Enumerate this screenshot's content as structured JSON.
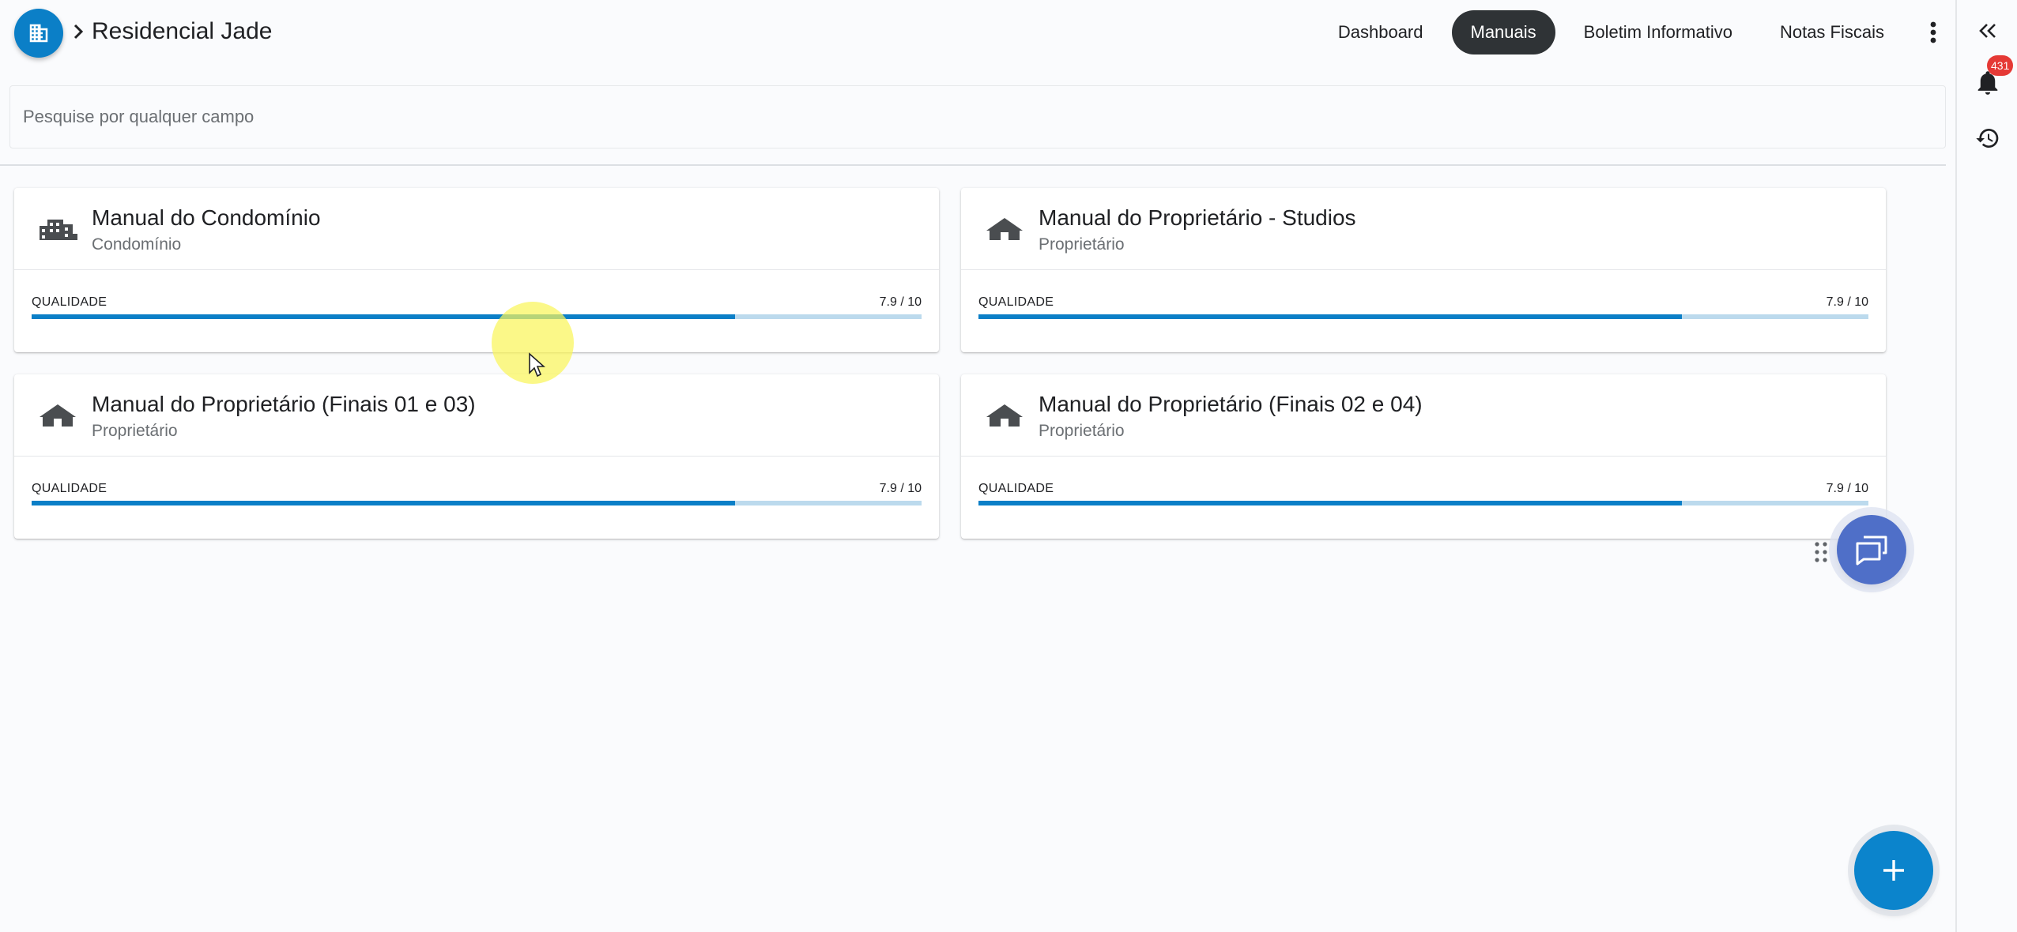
{
  "header": {
    "title": "Residencial Jade",
    "nav": [
      "Dashboard",
      "Manuais",
      "Boletim Informativo",
      "Notas Fiscais"
    ],
    "active_nav": "Manuais"
  },
  "search": {
    "placeholder": "Pesquise por qualquer campo",
    "value": ""
  },
  "cards": [
    {
      "title": "Manual do Condomínio",
      "subtitle": "Condomínio",
      "icon": "buildings-icon",
      "quality_label": "QUALIDADE",
      "quality_text": "7.9 / 10",
      "quality_value": 7.9,
      "quality_max": 10
    },
    {
      "title": "Manual do Proprietário - Studios",
      "subtitle": "Proprietário",
      "icon": "house-icon",
      "quality_label": "QUALIDADE",
      "quality_text": "7.9 / 10",
      "quality_value": 7.9,
      "quality_max": 10
    },
    {
      "title": "Manual do Proprietário (Finais 01 e 03)",
      "subtitle": "Proprietário",
      "icon": "house-icon",
      "quality_label": "QUALIDADE",
      "quality_text": "7.9 / 10",
      "quality_value": 7.9,
      "quality_max": 10
    },
    {
      "title": "Manual do Proprietário (Finais 02 e 04)",
      "subtitle": "Proprietário",
      "icon": "house-icon",
      "quality_label": "QUALIDADE",
      "quality_text": "7.9 / 10",
      "quality_value": 7.9,
      "quality_max": 10
    }
  ],
  "rail": {
    "notifications_count": "431",
    "icons": [
      "double-chevron-left-icon",
      "bell-icon",
      "history-icon"
    ]
  },
  "fabs": {
    "chat_icon": "chat-icon",
    "add_icon": "plus-icon"
  },
  "colors": {
    "brand": "#0b7fc7",
    "active_tab": "#2f3336",
    "badge": "#e53935",
    "chat_fab": "#4f6fc8",
    "progress_track": "#bcdaed"
  }
}
